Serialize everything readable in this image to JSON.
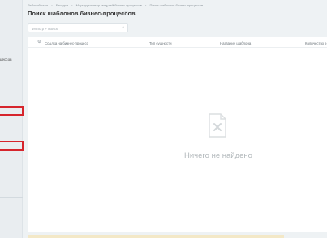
{
  "sidebar": {
    "partial_text": "цессов"
  },
  "breadcrumb": {
    "items": [
      "Рабочий стол",
      "Беседки",
      "Маршрутизатор модулей бизнес-процессов",
      "Поиск шаблонов бизнес-процессов"
    ],
    "separator": "›"
  },
  "page": {
    "title": "Поиск шаблонов бизнес-процессов",
    "star_icon": "☆"
  },
  "search": {
    "placeholder": "Фильтр + поиск",
    "icon": "search-icon"
  },
  "table": {
    "columns": [
      "Ссылка на бизнес-процесс",
      "Тип сущности",
      "Название шаблона",
      "Количество э"
    ]
  },
  "empty_state": {
    "message": "Ничего не найдено"
  },
  "colors": {
    "highlight": "#d6252c",
    "background": "#eef2f4",
    "empty_text": "#b2b8bb"
  }
}
